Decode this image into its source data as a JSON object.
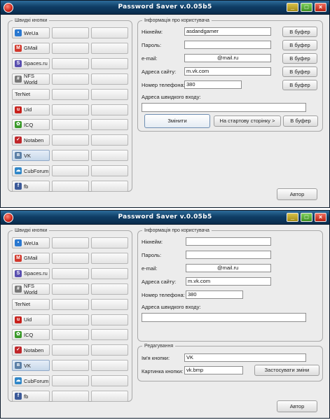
{
  "win1": {
    "title": "Password Saver v.0.05b5",
    "quick_legend": "Швидкі кнопки",
    "quick": [
      {
        "label": "WeUa",
        "icon": "weua-icon",
        "color": "#2a78d0",
        "glyph": "▪"
      },
      {
        "label": "GMail",
        "icon": "gmail-icon",
        "color": "#d2372b",
        "glyph": "M"
      },
      {
        "label": "Spaces.ru",
        "icon": "spaces-icon",
        "color": "#5a4fb0",
        "glyph": "S"
      },
      {
        "label": "NFS World",
        "icon": "nfs-icon",
        "color": "#777777",
        "glyph": "#"
      },
      {
        "label": "TerNet",
        "icon": "",
        "color": "",
        "glyph": ""
      },
      {
        "label": "Uid",
        "icon": "uid-icon",
        "color": "#c8201b",
        "glyph": "u"
      },
      {
        "label": "ICQ",
        "icon": "icq-icon",
        "color": "#3a9a2a",
        "glyph": "✿"
      },
      {
        "label": "Notaben",
        "icon": "notaben-icon",
        "color": "#c0262a",
        "glyph": "✓"
      },
      {
        "label": "VK",
        "icon": "vk-icon",
        "color": "#5b7fa6",
        "glyph": "в"
      },
      {
        "label": "CubForum",
        "icon": "cubforum-icon",
        "color": "#2f86c8",
        "glyph": "☁"
      },
      {
        "label": "fb",
        "icon": "facebook-icon",
        "color": "#3b5998",
        "glyph": "f"
      }
    ],
    "info_legend": "Інформація про користувача",
    "labels": {
      "nick": "Нікнейм:",
      "password": "Пароль:",
      "email": "e-mail:",
      "site": "Адреса сайту:",
      "phone": "Номер телефона:",
      "quick": "Адреса швидкого входу:"
    },
    "values": {
      "nick": "asdandgamer",
      "password": "",
      "email": "@mail.ru",
      "site": "m.vk.com",
      "phone": "380",
      "quick": ""
    },
    "buffer_label": "В буфер",
    "change_label": "Змінити",
    "start_page_label": "На стартову сторінку >",
    "author_label": "Автор"
  },
  "win2": {
    "title": "Password Saver v.0.05b5",
    "quick_legend": "Швидкі кнопки",
    "quick": [
      {
        "label": "WeUa",
        "icon": "weua-icon",
        "color": "#2a78d0",
        "glyph": "▪"
      },
      {
        "label": "GMail",
        "icon": "gmail-icon",
        "color": "#d2372b",
        "glyph": "M"
      },
      {
        "label": "Spaces.ru",
        "icon": "spaces-icon",
        "color": "#5a4fb0",
        "glyph": "S"
      },
      {
        "label": "NFS World",
        "icon": "nfs-icon",
        "color": "#777777",
        "glyph": "#"
      },
      {
        "label": "TerNet",
        "icon": "",
        "color": "",
        "glyph": ""
      },
      {
        "label": "Uid",
        "icon": "uid-icon",
        "color": "#c8201b",
        "glyph": "u"
      },
      {
        "label": "ICQ",
        "icon": "icq-icon",
        "color": "#3a9a2a",
        "glyph": "✿"
      },
      {
        "label": "Notaben",
        "icon": "notaben-icon",
        "color": "#c0262a",
        "glyph": "✓"
      },
      {
        "label": "VK",
        "icon": "vk-icon",
        "color": "#5b7fa6",
        "glyph": "в"
      },
      {
        "label": "CubForum",
        "icon": "cubforum-icon",
        "color": "#2f86c8",
        "glyph": "☁"
      },
      {
        "label": "fb",
        "icon": "facebook-icon",
        "color": "#3b5998",
        "glyph": "f"
      }
    ],
    "info_legend": "Інформація про користувача",
    "labels": {
      "nick": "Нікнейм:",
      "password": "Пароль:",
      "email": "e-mail:",
      "site": "Адреса сайту:",
      "phone": "Номер телефона:",
      "quick": "Адреса швидкого входу:"
    },
    "values": {
      "nick": "",
      "password": "",
      "email": "@mail.ru",
      "site": "m.vk.com",
      "phone": "380",
      "quick": ""
    },
    "edit_legend": "Редагування",
    "edit": {
      "button_name_label": "Ім'я кнопки:",
      "button_name_value": "VK",
      "button_image_label": "Картинка кнопки:",
      "button_image_value": "vk.bmp",
      "apply_label": "Застосувати зміни"
    },
    "author_label": "Автор"
  }
}
